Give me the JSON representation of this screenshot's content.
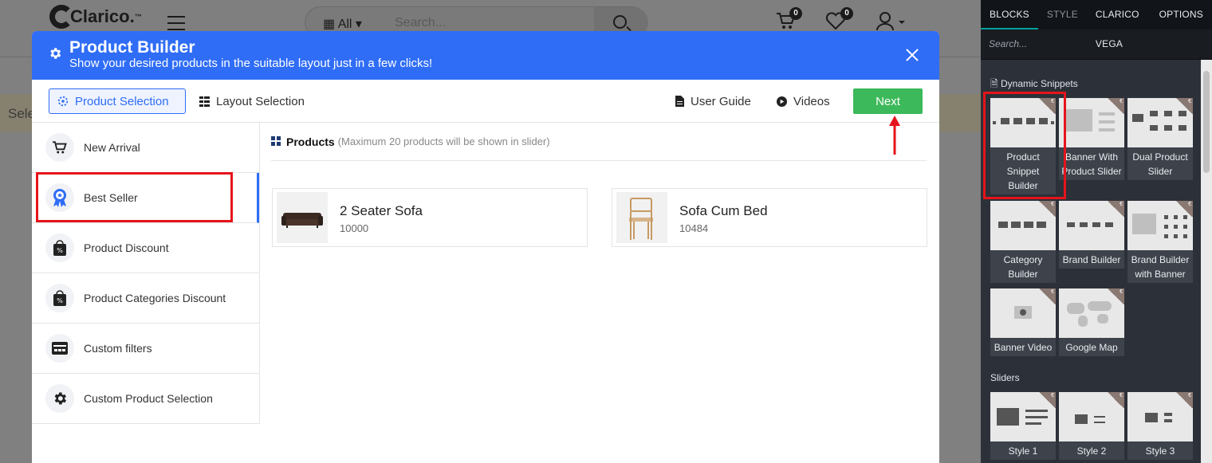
{
  "site": {
    "logo_text": "Clarico.",
    "logo_tm": "™",
    "search_category": "All",
    "search_placeholder": "Search...",
    "cart_count": "0",
    "wishlist_count": "0",
    "subbar_text": "Sele"
  },
  "modal": {
    "title": "Product Builder",
    "subtitle": "Show your desired products in the suitable layout just in a few clicks!",
    "tabs": [
      "Product Selection",
      "Layout Selection"
    ],
    "links": [
      "User Guide",
      "Videos"
    ],
    "next_label": "Next",
    "sidebar": [
      {
        "label": "New Arrival",
        "icon": "cart-icon"
      },
      {
        "label": "Best Seller",
        "icon": "award-icon"
      },
      {
        "label": "Product Discount",
        "icon": "discount-bag-icon"
      },
      {
        "label": "Product Categories Discount",
        "icon": "discount-bag-icon"
      },
      {
        "label": "Custom filters",
        "icon": "filter-card-icon"
      },
      {
        "label": "Custom Product Selection",
        "icon": "gear-icon"
      }
    ],
    "products_heading": "Products",
    "products_hint": "(Maximum 20 products will be shown in slider)",
    "products": [
      {
        "name": "2 Seater Sofa",
        "code": "10000",
        "thumb": "sofa-image"
      },
      {
        "name": "Sofa Cum Bed",
        "code": "10484",
        "thumb": "chair-image"
      }
    ]
  },
  "panel": {
    "tabs": [
      "BLOCKS",
      "STYLE",
      "CLARICO VEGA",
      "OPTIONS"
    ],
    "search_placeholder": "Search...",
    "sections": {
      "dynamic": "Dynamic Snippets",
      "sliders": "Sliders"
    },
    "dynamic_snippets": [
      "Product Snippet Builder",
      "Banner With Product Slider",
      "Dual Product Slider",
      "Category Builder",
      "Brand Builder",
      "Brand Builder with Banner",
      "Banner Video",
      "Google Map"
    ],
    "slider_snippets": [
      "Style 1",
      "Style 2",
      "Style 3"
    ]
  },
  "colors": {
    "modal_header": "#2f6df6",
    "next_button": "#3cb95a",
    "highlight": "#e6141b",
    "panel_bg": "#22262e"
  }
}
